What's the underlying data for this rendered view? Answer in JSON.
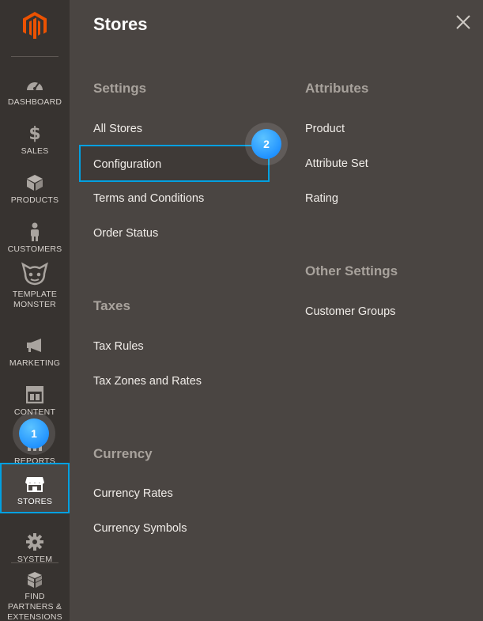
{
  "sidebar": {
    "items": [
      {
        "label": "DASHBOARD",
        "icon": "dashboard-icon"
      },
      {
        "label": "SALES",
        "icon": "dollar-icon"
      },
      {
        "label": "PRODUCTS",
        "icon": "box-icon"
      },
      {
        "label": "CUSTOMERS",
        "icon": "person-icon"
      },
      {
        "label": "TEMPLATE MONSTER",
        "icon": "template-monster-icon"
      },
      {
        "label": "MARKETING",
        "icon": "megaphone-icon"
      },
      {
        "label": "CONTENT",
        "icon": "layout-icon"
      },
      {
        "label": "REPORTS",
        "icon": "bar-chart-icon"
      },
      {
        "label": "STORES",
        "icon": "store-icon"
      },
      {
        "label": "SYSTEM",
        "icon": "gear-icon"
      },
      {
        "label": "FIND PARTNERS & EXTENSIONS",
        "icon": "cubes-icon"
      }
    ],
    "active": "STORES"
  },
  "panel": {
    "title": "Stores",
    "settings": {
      "title": "Settings",
      "links": [
        "All Stores",
        "Configuration",
        "Terms and Conditions",
        "Order Status"
      ]
    },
    "taxes": {
      "title": "Taxes",
      "links": [
        "Tax Rules",
        "Tax Zones and Rates"
      ]
    },
    "currency": {
      "title": "Currency",
      "links": [
        "Currency Rates",
        "Currency Symbols"
      ]
    },
    "attributes": {
      "title": "Attributes",
      "links": [
        "Product",
        "Attribute Set",
        "Rating"
      ]
    },
    "other": {
      "title": "Other Settings",
      "links": [
        "Customer Groups"
      ]
    }
  },
  "badges": {
    "step1": "1",
    "step2": "2"
  },
  "colors": {
    "accent": "#00a0e1",
    "logo": "#eb5202",
    "badge": "#1e90ff"
  }
}
